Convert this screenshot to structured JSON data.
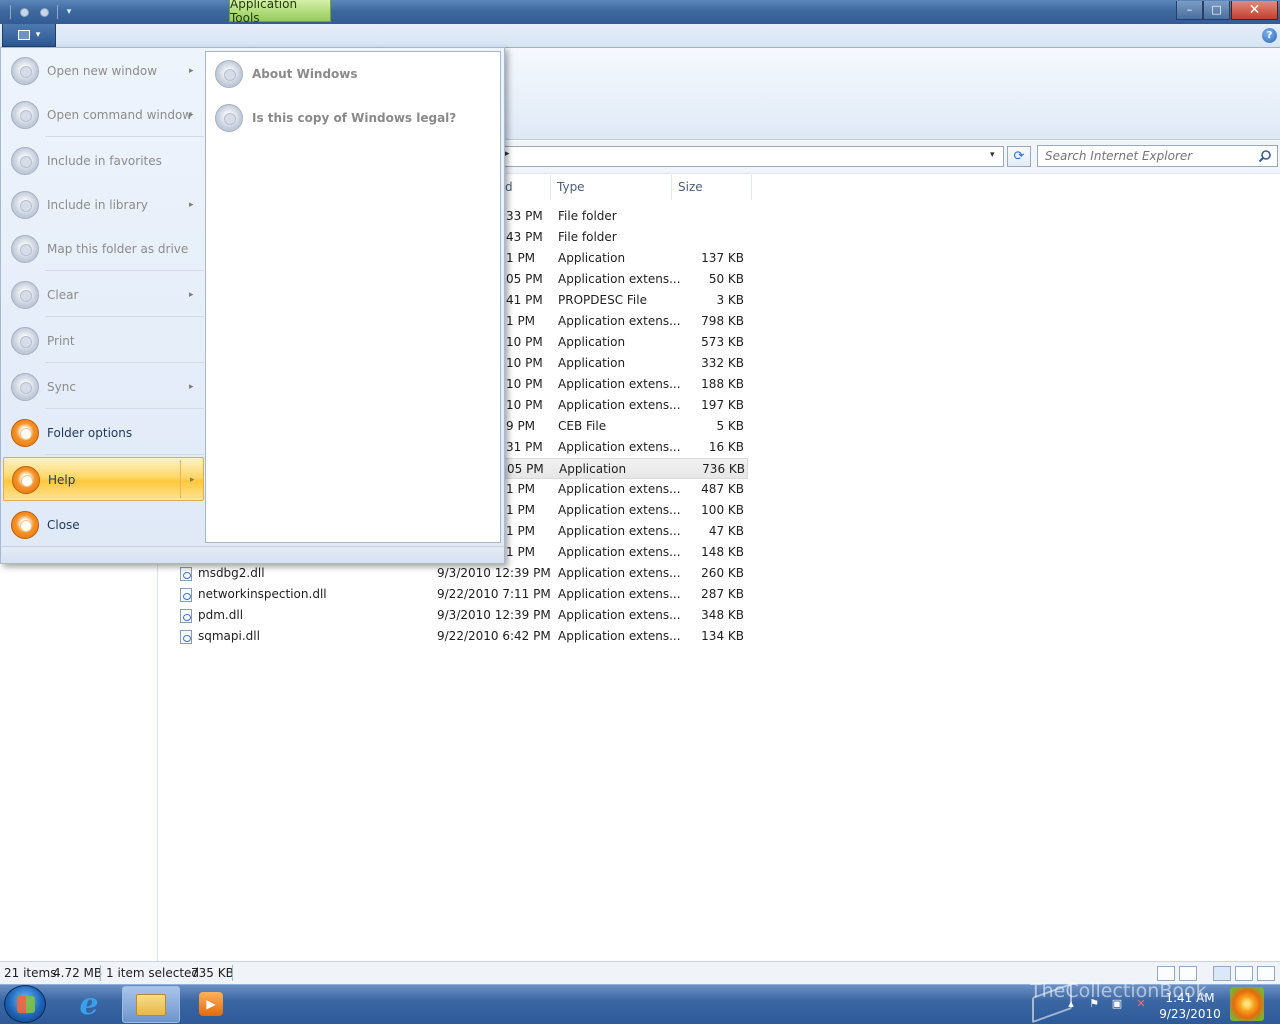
{
  "titlebar": {
    "context_tab": "Application Tools",
    "minimize": "–",
    "maximize": "□",
    "close": "✕"
  },
  "ribbon": {
    "help_glyph": "?"
  },
  "address": {
    "chevron": "▸",
    "dropdown": "▾",
    "refresh_glyph": "⟳",
    "search_placeholder": "Search Internet Explorer"
  },
  "columns": {
    "date_fragment": "d",
    "type": "Type",
    "size": "Size"
  },
  "files": [
    {
      "name": "",
      "date": "33 PM",
      "type": "File folder",
      "size": ""
    },
    {
      "name": "",
      "date": "43 PM",
      "type": "File folder",
      "size": ""
    },
    {
      "name": "",
      "date": "1 PM",
      "type": "Application",
      "size": "137 KB"
    },
    {
      "name": "",
      "date": "05 PM",
      "type": "Application extens...",
      "size": "50 KB"
    },
    {
      "name": "",
      "date": "41 PM",
      "type": "PROPDESC File",
      "size": "3 KB"
    },
    {
      "name": "",
      "date": "1 PM",
      "type": "Application extens...",
      "size": "798 KB"
    },
    {
      "name": "",
      "date": "10 PM",
      "type": "Application",
      "size": "573 KB"
    },
    {
      "name": "",
      "date": "10 PM",
      "type": "Application",
      "size": "332 KB"
    },
    {
      "name": "",
      "date": "10 PM",
      "type": "Application extens...",
      "size": "188 KB"
    },
    {
      "name": "",
      "date": "10 PM",
      "type": "Application extens...",
      "size": "197 KB"
    },
    {
      "name": "",
      "date": "9 PM",
      "type": "CEB File",
      "size": "5 KB"
    },
    {
      "name": "",
      "date": "31 PM",
      "type": "Application extens...",
      "size": "16 KB"
    },
    {
      "name": "",
      "date": "05 PM",
      "type": "Application",
      "size": "736 KB",
      "selected": true
    },
    {
      "name": "",
      "date": "1 PM",
      "type": "Application extens...",
      "size": "487 KB"
    },
    {
      "name": "",
      "date": "1 PM",
      "type": "Application extens...",
      "size": "100 KB"
    },
    {
      "name": "",
      "date": "1 PM",
      "type": "Application extens...",
      "size": "47 KB"
    },
    {
      "name": "",
      "date": "1 PM",
      "type": "Application extens...",
      "size": "148 KB"
    },
    {
      "name": "msdbg2.dll",
      "date": "9/3/2010 12:39 PM",
      "type": "Application extens...",
      "size": "260 KB"
    },
    {
      "name": "networkinspection.dll",
      "date": "9/22/2010 7:11 PM",
      "type": "Application extens...",
      "size": "287 KB"
    },
    {
      "name": "pdm.dll",
      "date": "9/3/2010 12:39 PM",
      "type": "Application extens...",
      "size": "348 KB"
    },
    {
      "name": "sqmapi.dll",
      "date": "9/22/2010 6:42 PM",
      "type": "Application extens...",
      "size": "134 KB"
    }
  ],
  "app_menu": {
    "items": [
      {
        "label": "Open new window",
        "has_arrow": true,
        "enabled": false
      },
      {
        "label": "Open command window",
        "has_arrow": true,
        "enabled": false
      },
      {
        "label": "Include in favorites",
        "has_arrow": false,
        "enabled": false
      },
      {
        "label": "Include in library",
        "has_arrow": true,
        "enabled": false
      },
      {
        "label": "Map this folder as drive",
        "has_arrow": false,
        "enabled": false
      },
      {
        "label": "Clear",
        "has_arrow": true,
        "enabled": false
      },
      {
        "label": "Print",
        "has_arrow": false,
        "enabled": false
      },
      {
        "label": "Sync",
        "has_arrow": true,
        "enabled": false
      },
      {
        "label": "Folder options",
        "has_arrow": false,
        "enabled": true
      },
      {
        "label": "Help",
        "has_arrow": true,
        "enabled": true,
        "highlighted": true
      },
      {
        "label": "Close",
        "has_arrow": false,
        "enabled": true
      }
    ],
    "arrow_glyph": "▸",
    "submenu": [
      {
        "label": "About Windows"
      },
      {
        "label": "Is this copy of Windows legal?"
      }
    ]
  },
  "statusbar": {
    "items_count": "21 items",
    "total_size": "4.72 MB",
    "selection": "1 item selected",
    "selection_size": "735 KB"
  },
  "taskbar": {
    "ie_glyph": "e",
    "media_glyph": "▶",
    "tray_flag": "⚑",
    "tray_network": "▣",
    "tray_volume": "✕",
    "tray_arrow": "▴",
    "time": "1:41 AM",
    "date": "9/23/2010",
    "watermark": "TheCollectionBook"
  },
  "colors": {
    "accent_orange": "#e06d0a",
    "menu_highlight": "#ffc83c",
    "titlebar_blue": "#3f6aa0",
    "context_green": "#96cc5a"
  }
}
